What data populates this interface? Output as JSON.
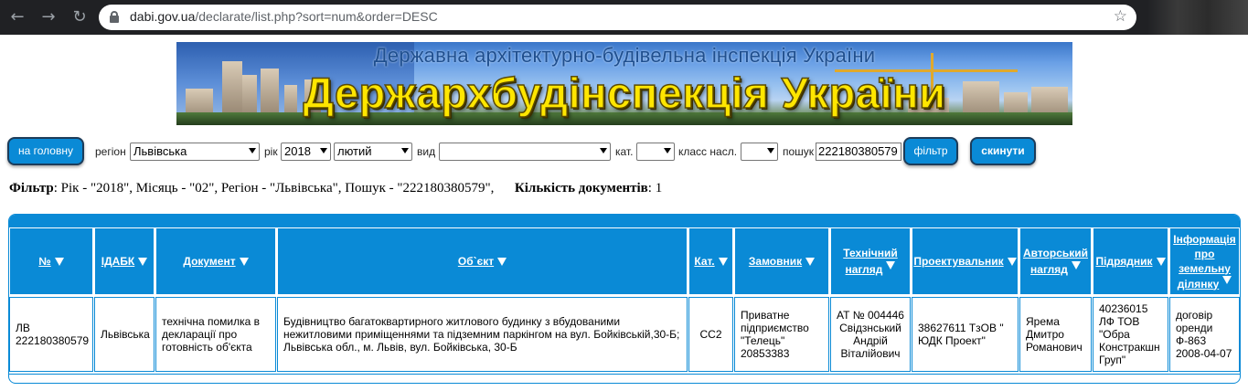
{
  "browser": {
    "url_host": "dabi.gov.ua",
    "url_path": "/declarate/list.php?sort=num&order=DESC",
    "icons": [
      "back-icon",
      "forward-icon",
      "reload-icon",
      "lock-icon",
      "star-icon"
    ]
  },
  "banner": {
    "subtitle": "Державна архітектурно-будівельна інспекція України",
    "title": "Держархбудінспекція України"
  },
  "filters": {
    "home_button": "на головну",
    "region_label": "регіон",
    "region_value": "Львівська",
    "year_label": "рік",
    "year_value": "2018",
    "month_value": "лютий",
    "kind_label": "вид",
    "kind_value": "",
    "cat_label": "кат.",
    "cat_value": "",
    "class_label": "класс насл.",
    "class_value": "",
    "search_label": "пошук",
    "search_value": "222180380579",
    "filter_button": "фільтр",
    "reset_button": "скинути"
  },
  "summary": {
    "filter_label": "Фільтр",
    "filter_text": ": Рік - \"2018\", Місяць - \"02\", Регіон - \"Львівська\", Пошук - \"222180380579\",",
    "count_label": "Кількість документів",
    "count_text": ": 1"
  },
  "table": {
    "headers": {
      "num": "№",
      "idabk": "ІДАБК",
      "document": "Документ",
      "object": "Об`єкт",
      "cat": "Кат.",
      "customer": "Замовник",
      "tech_1": "Технічний",
      "tech_2": "нагляд",
      "designer": "Проектувальник",
      "author_1": "Авторський",
      "author_2": "нагляд",
      "contractor": "Підрядник",
      "land_1": "Інформація",
      "land_2": "про",
      "land_3": "земельну",
      "land_4": "ділянку"
    },
    "row": {
      "num_1": "ЛВ",
      "num_2": "222180380579",
      "idabk": "Львівська",
      "document_1": "технічна помилка в",
      "document_2": "декларації про",
      "document_3": "готовність об'єкта",
      "object_1": "Будівництво багатоквартирного житлового будинку з вбудованими",
      "object_2": "нежитловими приміщеннями та підземним паркінгом на вул. Бойківській,30-Б;",
      "object_3": "Львівська обл., м. Львів, вул. Бойківська, 30-Б",
      "cat": "СС2",
      "customer_1": "Приватне",
      "customer_2": "підприємство",
      "customer_3": "\"Телець\"",
      "customer_4": "20853383",
      "tech_1": "АТ № 004446",
      "tech_2": "Свідзнський",
      "tech_3": "Андрій",
      "tech_4": "Віталійович",
      "designer_1": "38627611 ТзОВ \"",
      "designer_2": "ЮДК Проект\"",
      "author_1": "Ярема",
      "author_2": "Дмитро",
      "author_3": "Романович",
      "contractor_1": "40236015",
      "contractor_2": "ЛФ ТОВ",
      "contractor_3": "\"Обра",
      "contractor_4": "Констракшн",
      "contractor_5": "Груп\"",
      "land_1": "договір",
      "land_2": "оренди",
      "land_3": "Ф-863",
      "land_4": "2008-04-07"
    }
  },
  "colors": {
    "accent": "#0a8ad6",
    "banner_title": "#ffe600"
  }
}
